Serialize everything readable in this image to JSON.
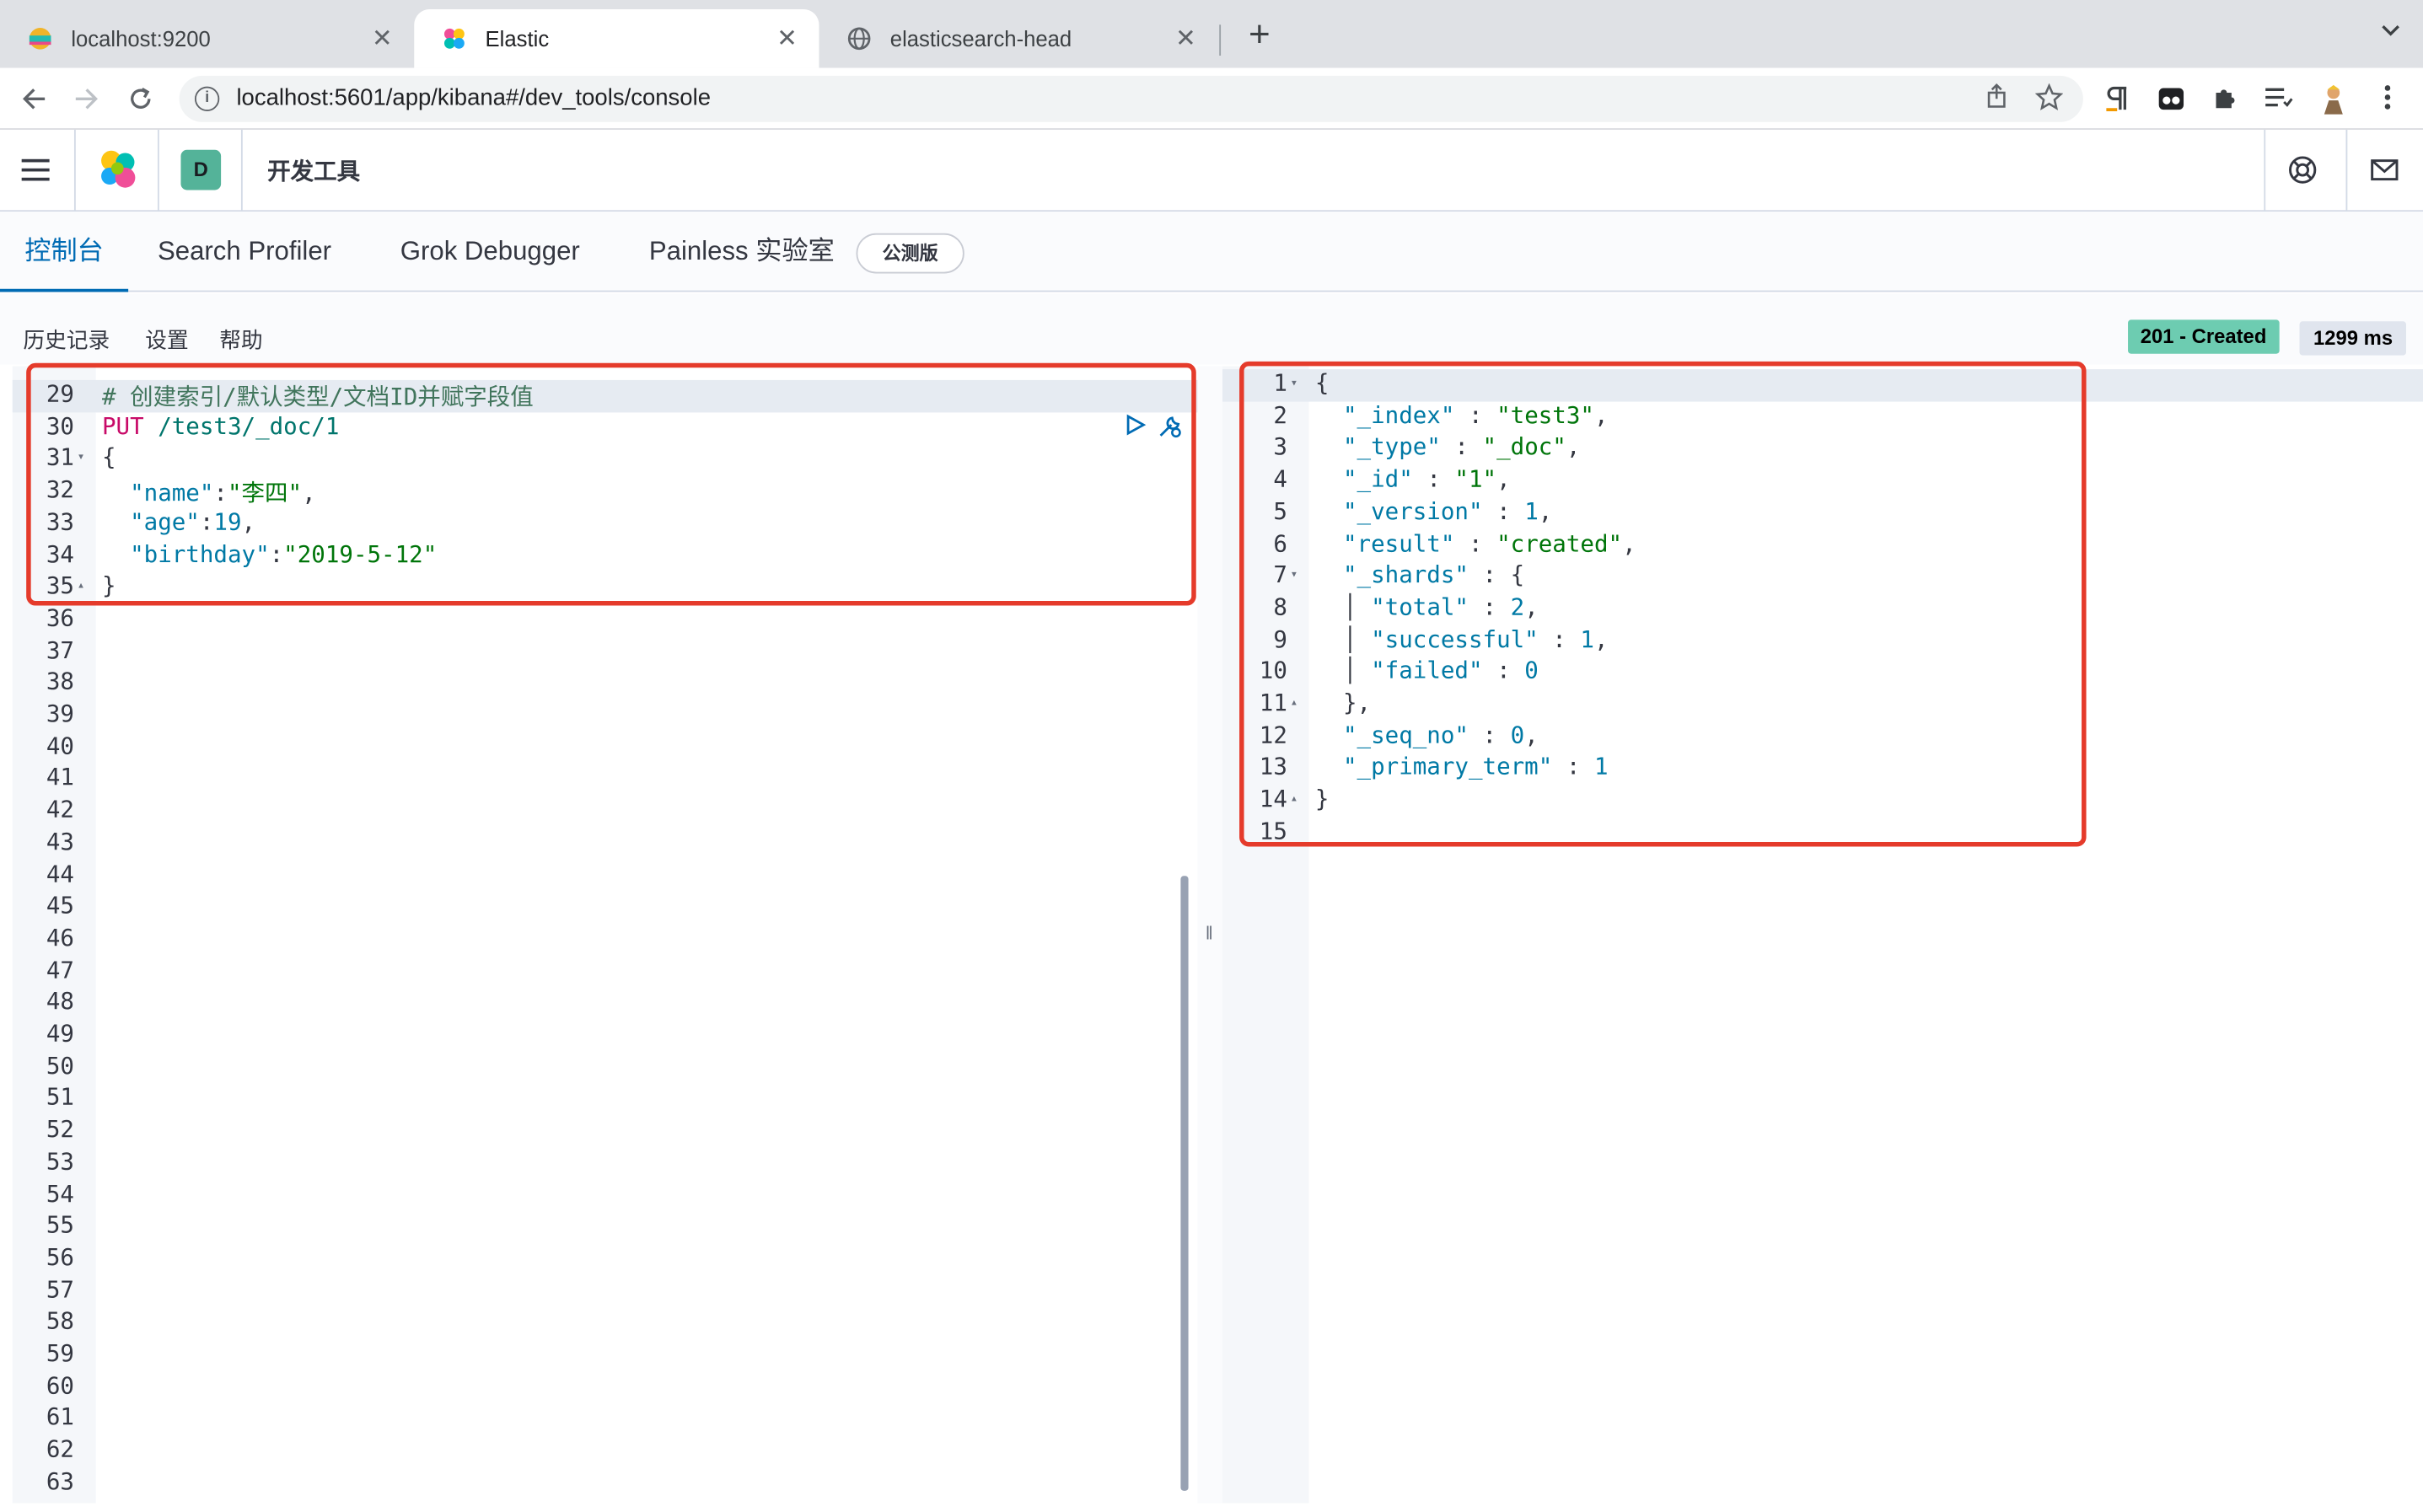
{
  "browser": {
    "tabs": [
      {
        "title": "localhost:9200",
        "close": "✕"
      },
      {
        "title": "Elastic",
        "close": "✕"
      },
      {
        "title": "elasticsearch-head",
        "close": "✕"
      }
    ],
    "new_tab": "+",
    "url": "localhost:5601/app/kibana#/dev_tools/console"
  },
  "kibana": {
    "space_initial": "D",
    "breadcrumb": "开发工具"
  },
  "devtools_tabs": [
    {
      "label": "控制台"
    },
    {
      "label": "Search Profiler"
    },
    {
      "label": "Grok Debugger"
    },
    {
      "label": "Painless 实验室"
    }
  ],
  "beta_badge": "公测版",
  "console_toolbar": {
    "history": "历史记录",
    "settings": "设置",
    "help": "帮助"
  },
  "response_status": {
    "status": "201 - Created",
    "timing": "1299 ms"
  },
  "colors": {
    "accent": "#006bb4",
    "status_green": "#6dccb1",
    "highlight_box": "#e53b2b"
  },
  "request_editor": {
    "first_line_number": 29,
    "last_line_number": 63,
    "lines": [
      {
        "tokens": [
          {
            "t": "# 创建索引/默认类型/文档ID并赋字段值",
            "c": "comment"
          }
        ]
      },
      {
        "tokens": [
          {
            "t": "PUT",
            "c": "method"
          },
          {
            "t": " /test3/_doc/1",
            "c": "path"
          }
        ]
      },
      {
        "tokens": [
          {
            "t": "{",
            "c": "punc"
          }
        ],
        "fold": "▾"
      },
      {
        "tokens": [
          {
            "t": "  ",
            "c": "punc"
          },
          {
            "t": "\"name\"",
            "c": "key"
          },
          {
            "t": ":",
            "c": "punc"
          },
          {
            "t": "\"李四\"",
            "c": "str"
          },
          {
            "t": ",",
            "c": "punc"
          }
        ]
      },
      {
        "tokens": [
          {
            "t": "  ",
            "c": "punc"
          },
          {
            "t": "\"age\"",
            "c": "key"
          },
          {
            "t": ":",
            "c": "punc"
          },
          {
            "t": "19",
            "c": "num"
          },
          {
            "t": ",",
            "c": "punc"
          }
        ]
      },
      {
        "tokens": [
          {
            "t": "  ",
            "c": "punc"
          },
          {
            "t": "\"birthday\"",
            "c": "key"
          },
          {
            "t": ":",
            "c": "punc"
          },
          {
            "t": "\"2019-5-12\"",
            "c": "str"
          }
        ]
      },
      {
        "tokens": [
          {
            "t": "}",
            "c": "punc"
          }
        ],
        "fold": "▴"
      }
    ]
  },
  "response_editor": {
    "lines": [
      {
        "n": "1",
        "fold": "▾",
        "tokens": [
          {
            "t": "{",
            "c": "punc"
          }
        ]
      },
      {
        "n": "2",
        "tokens": [
          {
            "t": "  ",
            "c": "punc"
          },
          {
            "t": "\"_index\"",
            "c": "key"
          },
          {
            "t": " : ",
            "c": "punc"
          },
          {
            "t": "\"test3\"",
            "c": "str"
          },
          {
            "t": ",",
            "c": "punc"
          }
        ]
      },
      {
        "n": "3",
        "tokens": [
          {
            "t": "  ",
            "c": "punc"
          },
          {
            "t": "\"_type\"",
            "c": "key"
          },
          {
            "t": " : ",
            "c": "punc"
          },
          {
            "t": "\"_doc\"",
            "c": "str"
          },
          {
            "t": ",",
            "c": "punc"
          }
        ]
      },
      {
        "n": "4",
        "tokens": [
          {
            "t": "  ",
            "c": "punc"
          },
          {
            "t": "\"_id\"",
            "c": "key"
          },
          {
            "t": " : ",
            "c": "punc"
          },
          {
            "t": "\"1\"",
            "c": "str"
          },
          {
            "t": ",",
            "c": "punc"
          }
        ]
      },
      {
        "n": "5",
        "tokens": [
          {
            "t": "  ",
            "c": "punc"
          },
          {
            "t": "\"_version\"",
            "c": "key"
          },
          {
            "t": " : ",
            "c": "punc"
          },
          {
            "t": "1",
            "c": "num"
          },
          {
            "t": ",",
            "c": "punc"
          }
        ]
      },
      {
        "n": "6",
        "tokens": [
          {
            "t": "  ",
            "c": "punc"
          },
          {
            "t": "\"result\"",
            "c": "key"
          },
          {
            "t": " : ",
            "c": "punc"
          },
          {
            "t": "\"created\"",
            "c": "str"
          },
          {
            "t": ",",
            "c": "punc"
          }
        ]
      },
      {
        "n": "7",
        "fold": "▾",
        "tokens": [
          {
            "t": "  ",
            "c": "punc"
          },
          {
            "t": "\"_shards\"",
            "c": "key"
          },
          {
            "t": " : {",
            "c": "punc"
          }
        ]
      },
      {
        "n": "8",
        "tokens": [
          {
            "t": "  │ ",
            "c": "punc"
          },
          {
            "t": "\"total\"",
            "c": "key"
          },
          {
            "t": " : ",
            "c": "punc"
          },
          {
            "t": "2",
            "c": "num"
          },
          {
            "t": ",",
            "c": "punc"
          }
        ]
      },
      {
        "n": "9",
        "tokens": [
          {
            "t": "  │ ",
            "c": "punc"
          },
          {
            "t": "\"successful\"",
            "c": "key"
          },
          {
            "t": " : ",
            "c": "punc"
          },
          {
            "t": "1",
            "c": "num"
          },
          {
            "t": ",",
            "c": "punc"
          }
        ]
      },
      {
        "n": "10",
        "tokens": [
          {
            "t": "  │ ",
            "c": "punc"
          },
          {
            "t": "\"failed\"",
            "c": "key"
          },
          {
            "t": " : ",
            "c": "punc"
          },
          {
            "t": "0",
            "c": "num"
          }
        ]
      },
      {
        "n": "11",
        "fold": "▴",
        "tokens": [
          {
            "t": "  },",
            "c": "punc"
          }
        ]
      },
      {
        "n": "12",
        "tokens": [
          {
            "t": "  ",
            "c": "punc"
          },
          {
            "t": "\"_seq_no\"",
            "c": "key"
          },
          {
            "t": " : ",
            "c": "punc"
          },
          {
            "t": "0",
            "c": "num"
          },
          {
            "t": ",",
            "c": "punc"
          }
        ]
      },
      {
        "n": "13",
        "tokens": [
          {
            "t": "  ",
            "c": "punc"
          },
          {
            "t": "\"_primary_term\"",
            "c": "key"
          },
          {
            "t": " : ",
            "c": "punc"
          },
          {
            "t": "1",
            "c": "num"
          }
        ]
      },
      {
        "n": "14",
        "fold": "▴",
        "tokens": [
          {
            "t": "}",
            "c": "punc"
          }
        ]
      },
      {
        "n": "15",
        "tokens": []
      }
    ]
  }
}
